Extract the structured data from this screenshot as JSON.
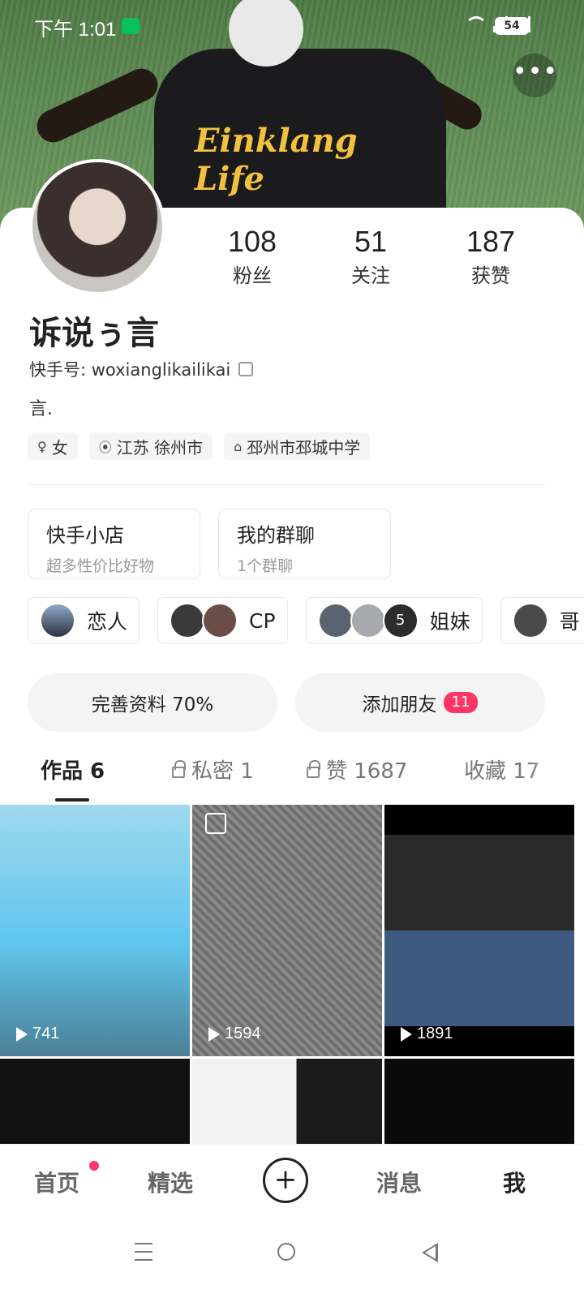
{
  "status_bar": {
    "time": "下午 1:01",
    "battery": "54"
  },
  "profile": {
    "name": "诉说ぅ言",
    "kuaishou_id_label": "快手号: woxianglikailikai",
    "bio": "言.",
    "stats": [
      {
        "value": "108",
        "label": "粉丝"
      },
      {
        "value": "51",
        "label": "关注"
      },
      {
        "value": "187",
        "label": "获赞"
      }
    ],
    "tags": [
      {
        "icon": "female-icon",
        "text": "女"
      },
      {
        "icon": "location-icon",
        "text": "江苏 徐州市"
      },
      {
        "icon": "school-icon",
        "text": "邳州市邳城中学"
      }
    ]
  },
  "cards": [
    {
      "title": "快手小店",
      "subtitle": "超多性价比好物"
    },
    {
      "title": "我的群聊",
      "subtitle": "1个群聊"
    }
  ],
  "relation_chips": [
    {
      "label": "恋人"
    },
    {
      "label": "CP"
    },
    {
      "label": "姐妹",
      "extra_count": "5"
    },
    {
      "label": "哥"
    }
  ],
  "actions": {
    "complete_profile": "完善资料 70%",
    "add_friend": "添加朋友",
    "add_friend_badge": "11"
  },
  "tabs": [
    {
      "label": "作品 6",
      "locked": false
    },
    {
      "label": "私密 1",
      "locked": true
    },
    {
      "label": "赞 1687",
      "locked": true
    },
    {
      "label": "收藏 17",
      "locked": false
    }
  ],
  "works": [
    {
      "views": "741"
    },
    {
      "views": "1594"
    },
    {
      "views": "1891"
    }
  ],
  "bottom_nav": [
    {
      "label": "首页"
    },
    {
      "label": "精选"
    },
    {
      "label": "消息"
    },
    {
      "label": "我"
    }
  ],
  "colors": {
    "accent": "#fe3666",
    "text": "#222222"
  }
}
